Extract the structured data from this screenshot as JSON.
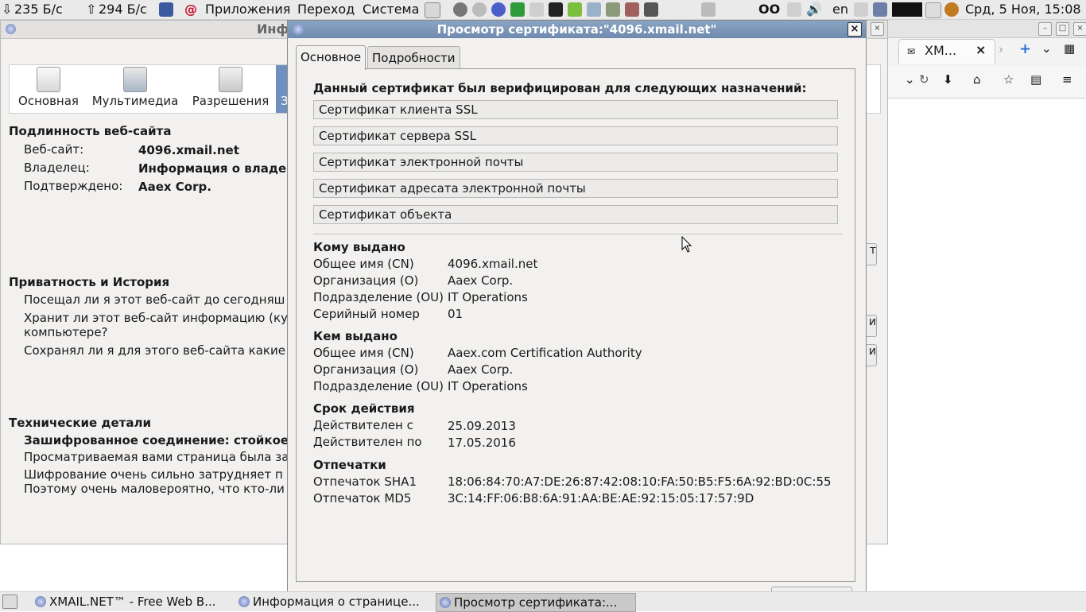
{
  "top_panel": {
    "net_down": "235 Б/с",
    "net_up": "294 Б/с",
    "menu": [
      "Приложения",
      "Переход",
      "Система"
    ],
    "keyboard_layout": "en",
    "clock": "Срд,  5 Ноя, 15:08"
  },
  "firefox_window": {
    "tab_title": "XM...",
    "tab_close": "×"
  },
  "page_info": {
    "title": "Инф",
    "tabs": [
      {
        "label": "Основная"
      },
      {
        "label": "Мультимедиа"
      },
      {
        "label": "Разрешения"
      },
      {
        "label": "З"
      }
    ],
    "identity": {
      "heading": "Подлинность веб-сайта",
      "rows": [
        {
          "label": "Веб-сайт:",
          "value": "4096.xmail.net"
        },
        {
          "label": "Владелец:",
          "value": "Информация о владе"
        },
        {
          "label": "Подтверждено:",
          "value": "Aaex Corp."
        }
      ]
    },
    "privacy": {
      "heading": "Приватность и История",
      "q1": "Посещал ли я этот веб-сайт до сегодняш",
      "q2_line1": "Хранит ли этот веб-сайт информацию (ку",
      "q2_line2": "компьютере?",
      "q3": "Сохранял ли я для этого веб-сайта какие"
    },
    "technical": {
      "heading": "Технические детали",
      "conn": "Зашифрованное соединение: стойкое",
      "line1": "Просматриваемая вами страница была за",
      "line2": "Шифрование очень сильно затрудняет п",
      "line3": "Поэтому очень маловероятно, что кто-ли"
    },
    "side_buttons": [
      "т",
      "и",
      "и"
    ]
  },
  "cert_dialog": {
    "title": "Просмотр сертификата:\"4096.xmail.net\"",
    "close": "×",
    "tabs": {
      "general": "Основное",
      "details": "Подробности"
    },
    "verified_heading": "Данный сертификат был верифицирован для следующих назначений:",
    "purposes": [
      "Сертификат клиента SSL",
      "Сертификат сервера SSL",
      "Сертификат электронной почты",
      "Сертификат адресата электронной почты",
      "Сертификат объекта"
    ],
    "issued_to": {
      "heading": "Кому выдано",
      "rows": [
        {
          "label": "Общее имя (CN)",
          "value": "4096.xmail.net"
        },
        {
          "label": "Организация (O)",
          "value": "Aaex Corp."
        },
        {
          "label": "Подразделение (OU)",
          "value": "IT Operations"
        },
        {
          "label": "Серийный номер",
          "value": "01"
        }
      ]
    },
    "issued_by": {
      "heading": "Кем выдано",
      "rows": [
        {
          "label": "Общее имя (CN)",
          "value": "Aaex.com Certification Authority"
        },
        {
          "label": "Организация (O)",
          "value": "Aaex Corp."
        },
        {
          "label": "Подразделение (OU)",
          "value": "IT Operations"
        }
      ]
    },
    "validity": {
      "heading": "Срок действия",
      "rows": [
        {
          "label": "Действителен с",
          "value": "25.09.2013"
        },
        {
          "label": "Действителен по",
          "value": "17.05.2016"
        }
      ]
    },
    "fingerprints": {
      "heading": "Отпечатки",
      "rows": [
        {
          "label": "Отпечаток SHA1",
          "value": "18:06:84:70:A7:DE:26:87:42:08:10:FA:50:B5:F5:6A:92:BD:0C:55"
        },
        {
          "label": "Отпечаток MD5",
          "value": "3C:14:FF:06:B8:6A:91:AA:BE:AE:92:15:05:17:57:9D"
        }
      ]
    }
  },
  "taskbar": {
    "items": [
      {
        "label": "XMAIL.NET™ - Free Web B..."
      },
      {
        "label": "Информация о странице..."
      },
      {
        "label": "Просмотр сертификата:..."
      }
    ]
  },
  "colors": {
    "titlebar_active": "#7a93b6",
    "window_bg": "#f2f1f0",
    "panel_bg": "#eaeaea"
  }
}
